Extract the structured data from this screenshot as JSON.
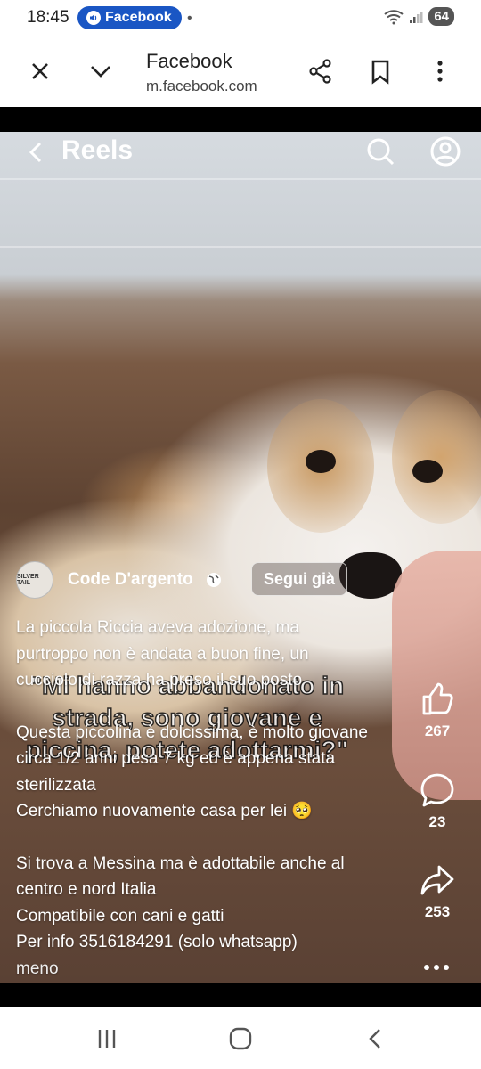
{
  "status_bar": {
    "time": "18:45",
    "app_pill": "Facebook",
    "battery": "64"
  },
  "browser": {
    "title": "Facebook",
    "url": "m.facebook.com",
    "icons": [
      "close-icon",
      "chevron-down-icon",
      "share-icon",
      "bookmark-icon",
      "more-vertical-icon"
    ]
  },
  "reels": {
    "header_title": "Reels",
    "icons": [
      "back-icon",
      "search-icon",
      "profile-icon"
    ]
  },
  "post": {
    "author": "Code D'argento",
    "avatar_text": "SILVER TAIL",
    "follow_label": "Segui già",
    "caption_paragraphs": [
      "La piccola Riccia aveva adozione, ma purtroppo non è andata a buon fine, un cucciolo di razza ha preso il suo posto",
      "Questa piccolina è dolcissima, è molto giovane circa 1/2 anni pesa 7 kg ed è appena stata sterilizzata",
      "Cerchiamo nuovamente casa per lei 🥺",
      "Si trova a Messina ma è adottabile anche al centro e nord Italia",
      "Compatibile con cani e gatti",
      "Per info 3516184291 (solo whatsapp)"
    ],
    "less_label": "meno",
    "video_overlay_text": "\"Mi hanno abbandonato in strada, sono giovane e piccina, potete adottarmi?\""
  },
  "actions": {
    "likes": "267",
    "comments": "23",
    "shares": "253"
  },
  "nav": {
    "icons": [
      "recent-apps-icon",
      "home-icon",
      "back-nav-icon"
    ]
  }
}
